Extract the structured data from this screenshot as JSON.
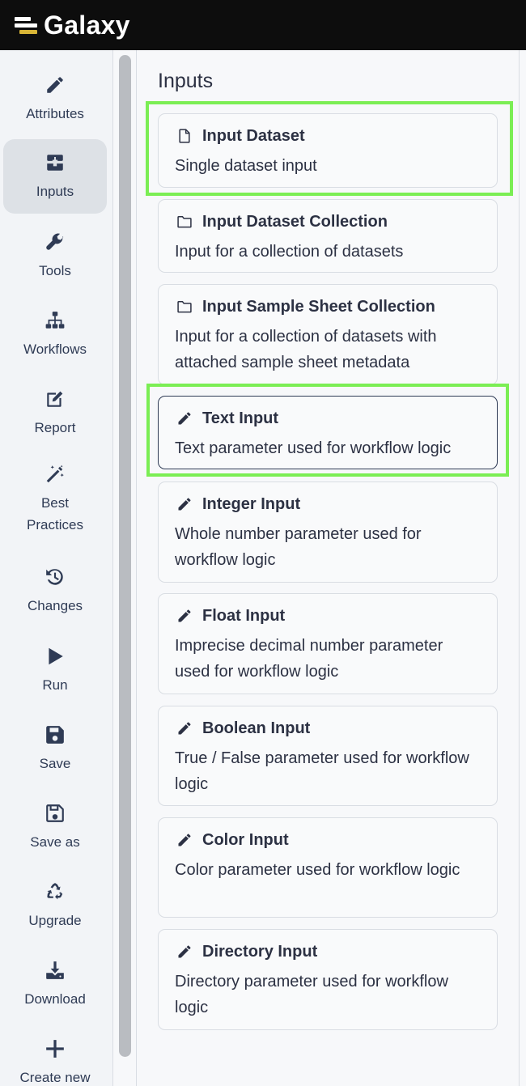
{
  "app": {
    "brand": "Galaxy"
  },
  "nav": [
    {
      "id": "attributes",
      "label": "Attributes",
      "icon": "pencil-icon"
    },
    {
      "id": "inputs",
      "label": "Inputs",
      "icon": "inputs-icon",
      "active": true
    },
    {
      "id": "tools",
      "label": "Tools",
      "icon": "wrench-icon"
    },
    {
      "id": "workflows",
      "label": "Workflows",
      "icon": "sitemap-icon"
    },
    {
      "id": "report",
      "label": "Report",
      "icon": "edit-icon"
    },
    {
      "id": "best-practices",
      "label": "Best\nPractices",
      "icon": "magic-wand-icon"
    },
    {
      "id": "changes",
      "label": "Changes",
      "icon": "history-icon"
    },
    {
      "id": "run",
      "label": "Run",
      "icon": "play-icon"
    },
    {
      "id": "save",
      "label": "Save",
      "icon": "save-icon"
    },
    {
      "id": "save-as",
      "label": "Save as",
      "icon": "save-outline-icon"
    },
    {
      "id": "upgrade",
      "label": "Upgrade",
      "icon": "recycle-icon"
    },
    {
      "id": "download",
      "label": "Download",
      "icon": "download-icon"
    },
    {
      "id": "create-new",
      "label": "Create new",
      "icon": "plus-icon"
    }
  ],
  "main": {
    "title": "Inputs",
    "cards": [
      {
        "title": "Input Dataset",
        "desc": "Single dataset input",
        "icon": "file-icon"
      },
      {
        "title": "Input Dataset Collection",
        "desc": "Input for a collection of datasets",
        "icon": "folder-icon"
      },
      {
        "title": "Input Sample Sheet Collection",
        "desc": "Input for a collection of datasets with attached sample sheet metadata",
        "icon": "folder-icon"
      },
      {
        "title": "Text Input",
        "desc": "Text parameter used for workflow logic",
        "icon": "pencil-icon",
        "selected": true
      },
      {
        "title": "Integer Input",
        "desc": "Whole number parameter used for workflow logic",
        "icon": "pencil-icon"
      },
      {
        "title": "Float Input",
        "desc": "Imprecise decimal number parameter used for workflow logic",
        "icon": "pencil-icon"
      },
      {
        "title": "Boolean Input",
        "desc": "True / False parameter used for workflow logic",
        "icon": "pencil-icon"
      },
      {
        "title": "Color Input",
        "desc": "Color parameter used for workflow logic",
        "icon": "pencil-icon"
      },
      {
        "title": "Directory Input",
        "desc": "Directory parameter used for workflow logic",
        "icon": "pencil-icon"
      }
    ]
  },
  "colors": {
    "highlight": "#7bee54",
    "topbar": "#0d0d0d",
    "active_nav": "#dde1e6"
  }
}
